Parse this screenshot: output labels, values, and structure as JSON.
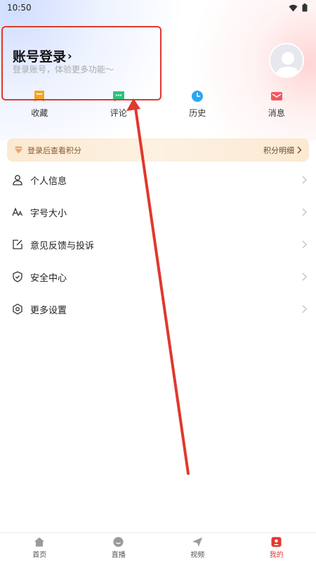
{
  "status_bar": {
    "time": "10:50"
  },
  "login": {
    "title": "账号登录",
    "chevron": "›",
    "subtitle": "登录账号，体验更多功能～"
  },
  "quick_actions": [
    {
      "label": "收藏",
      "icon": "bookmark-icon",
      "color": "#f5a623"
    },
    {
      "label": "评论",
      "icon": "comment-icon",
      "color": "#2ec27e"
    },
    {
      "label": "历史",
      "icon": "clock-icon",
      "color": "#2aa7f0"
    },
    {
      "label": "消息",
      "icon": "mail-icon",
      "color": "#f0585e"
    }
  ],
  "points": {
    "left_text": "登录后查看积分",
    "right_text": "积分明细"
  },
  "menu": [
    {
      "label": "个人信息",
      "icon": "user-icon"
    },
    {
      "label": "字号大小",
      "icon": "font-size-icon"
    },
    {
      "label": "意见反馈与投诉",
      "icon": "feedback-icon"
    },
    {
      "label": "安全中心",
      "icon": "shield-icon"
    },
    {
      "label": "更多设置",
      "icon": "settings-icon"
    }
  ],
  "tabs": [
    {
      "label": "首页",
      "icon": "home-icon",
      "active": false
    },
    {
      "label": "直播",
      "icon": "live-icon",
      "active": false
    },
    {
      "label": "视频",
      "icon": "video-icon",
      "active": false
    },
    {
      "label": "我的",
      "icon": "profile-icon",
      "active": true
    }
  ],
  "colors": {
    "accent": "#e0382e",
    "annotation": "#e0382e"
  }
}
